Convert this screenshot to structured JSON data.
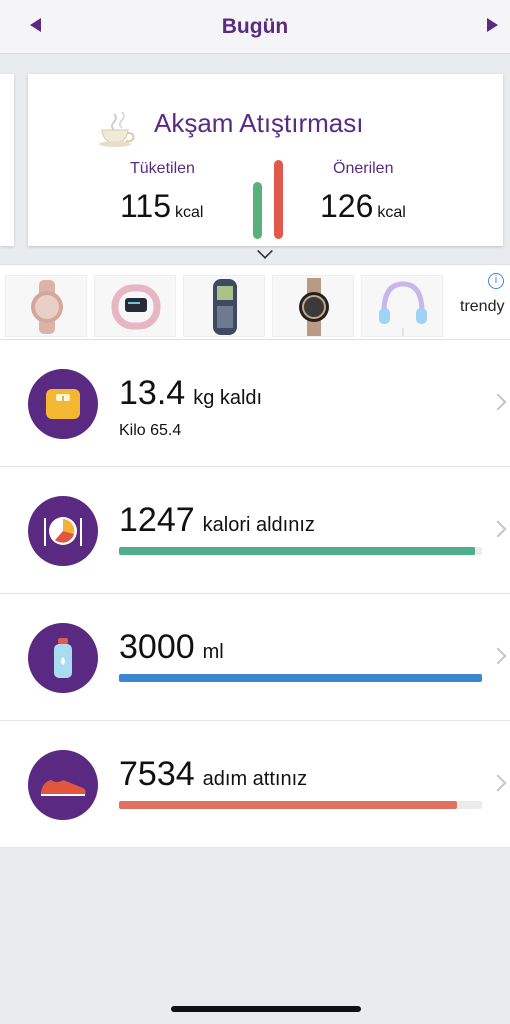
{
  "header": {
    "title": "Bugün"
  },
  "meal": {
    "title": "Akşam Atıştırması",
    "consumed_label": "Tüketilen",
    "consumed_value": "115",
    "recommended_label": "Önerilen",
    "recommended_value": "126",
    "unit": "kcal"
  },
  "ads": {
    "brand": "trendy",
    "items": [
      "smartwatch-rose-gold",
      "fitness-band-pink",
      "classic-mobile-phone",
      "fashion-smartwatch",
      "kids-headphones"
    ]
  },
  "rows": {
    "weight": {
      "value": "13.4",
      "suffix": "kg kaldı",
      "sub": "Kilo 65.4"
    },
    "calories": {
      "value": "1247",
      "suffix": "kalori aldınız",
      "progress": 0.98,
      "color": "#4caf8a"
    },
    "water": {
      "value": "3000",
      "suffix": "ml",
      "progress": 1.0,
      "color": "#3a87cf"
    },
    "steps": {
      "value": "7534",
      "suffix": "adım attınız",
      "progress": 0.93,
      "color": "#e0725f"
    }
  },
  "colors": {
    "brand_purple": "#5b2b82",
    "consumed_bar": "#5ab07a",
    "recommended_bar": "#e05a4c"
  }
}
